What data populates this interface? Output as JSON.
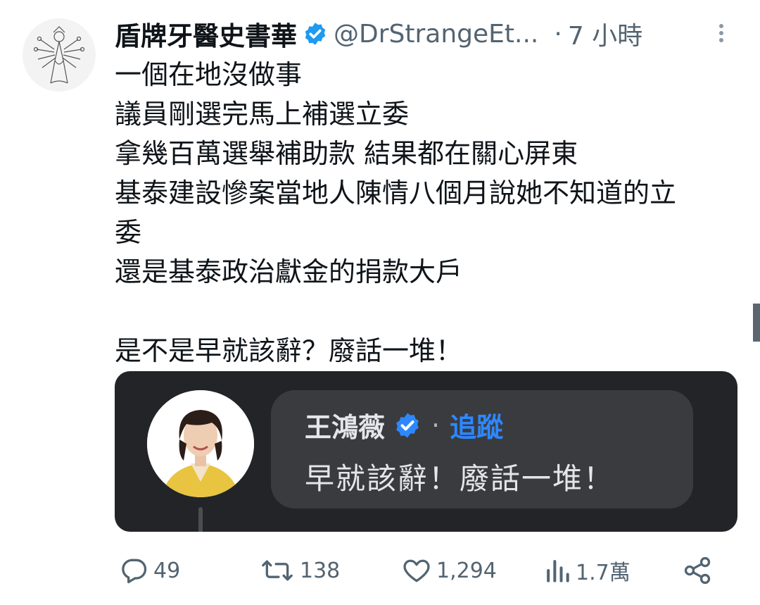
{
  "tweet": {
    "display_name": "盾牌牙醫史書華",
    "handle": "@DrStrangeEt...",
    "separator": "·",
    "time": "7 小時",
    "lines": [
      "一個在地沒做事",
      "議員剛選完馬上補選立委",
      "拿幾百萬選舉補助款 結果都在關心屏東",
      "基泰建設慘案當地人陳情八個月說她不知道的立",
      "委",
      "還是基泰政治獻金的捐款大戶",
      "",
      "是不是早就該辭？廢話一堆！"
    ]
  },
  "embedded": {
    "name": "王鴻薇",
    "separator": "·",
    "follow_label": "追蹤",
    "comment": "早就該辭！廢話一堆！"
  },
  "actions": {
    "replies": "49",
    "retweets": "138",
    "likes": "1,294",
    "views": "1.7萬"
  },
  "icons": {
    "verified": "verified-badge-icon",
    "more": "more-dots-icon",
    "reply": "reply-icon",
    "retweet": "retweet-icon",
    "like": "heart-icon",
    "views": "views-chart-icon",
    "share": "share-icon"
  },
  "colors": {
    "verified": "#1d9bf0",
    "card_bg": "#222427",
    "bubble_bg": "#3a3b3f",
    "follow": "#2d88ff",
    "muted": "#536471"
  }
}
